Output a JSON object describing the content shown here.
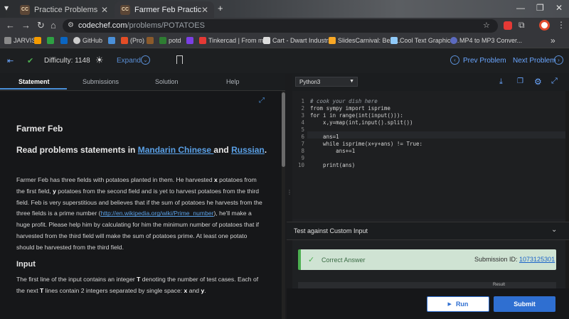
{
  "browser": {
    "tabs": [
      {
        "favicon": "CC",
        "title": "Practice Problems"
      },
      {
        "favicon": "CC",
        "title": "Farmer Feb Practice Coding Pro"
      }
    ],
    "new_tab": "+",
    "url_host": "codechef.com",
    "url_path": "/problems/POTATOES",
    "bookmarks": [
      {
        "label": "JARVIS",
        "color": "#8a8a8a"
      },
      {
        "label": "",
        "color": "#f59b00"
      },
      {
        "label": "",
        "color": "#2ea043"
      },
      {
        "label": "",
        "color": "#0a66c2"
      },
      {
        "label": "GitHub",
        "color": "#cccccc"
      },
      {
        "label": "",
        "color": "#4a90d9"
      },
      {
        "label": "(Pro)",
        "color": "#e44d26"
      },
      {
        "label": "",
        "color": "#8b5a2b"
      },
      {
        "label": "potd",
        "color": "#2e7d32"
      },
      {
        "label": "",
        "color": "#7b3fe4"
      },
      {
        "label": "Tinkercad | From mi...",
        "color": "#e53935"
      },
      {
        "label": "Cart - Dwart Industr...",
        "color": "#dddddd"
      },
      {
        "label": "SlidesCarnival: Best...",
        "color": "#f9a825"
      },
      {
        "label": "Cool Text Graphics...",
        "color": "#90caf9"
      },
      {
        "label": "MP4 to MP3 Conver...",
        "color": "#5c6bc0"
      }
    ],
    "more": "»"
  },
  "header": {
    "difficulty": "Difficulty: 1148",
    "expand": "Expand",
    "prev": "Prev Problem",
    "next": "Next Problem"
  },
  "tabs": [
    "Statement",
    "Submissions",
    "Solution",
    "Help"
  ],
  "statement": {
    "title": "Farmer Feb",
    "read_prefix": "Read problems statements in ",
    "link1": "Mandarin Chinese ",
    "and": "and ",
    "link2": "Russian",
    "period": ".",
    "para_1": "Farmer Feb has three fields with potatoes planted in them. He harvested ",
    "x": "x",
    "para_2": " potatoes from the first field, ",
    "y": "y",
    "para_3": " potatoes from the second field and is yet to harvest potatoes from the third field. Feb is very superstitious and believes that if the sum of potatoes he harvests from the three fields is a prime number (",
    "wiki": "http://en.wikipedia.org/wiki/Prime_number",
    "para_4": "), he'll make a huge profit. Please help him by calculating for him the minimum number of potatoes that if harvested from the third field will make the sum of potatoes prime. At least one potato should be harvested from the third field.",
    "input_heading": "Input",
    "input_1": "The first line of the input contains an integer ",
    "T": "T",
    "input_2": " denoting the number of test cases. Each of the next ",
    "T2": "T",
    "input_3": " lines contain 2 integers separated by single space: ",
    "x2": "x",
    "input_and": " and ",
    "y2": "y",
    "input_end": "."
  },
  "editor": {
    "language": "Python3",
    "lines": [
      "# cook your dish here",
      "from sympy import isprime",
      "for i in range(int(input())):",
      "    x,y=map(int,input().split())",
      "",
      "    ans=1",
      "    while isprime(x+y+ans) != True:",
      "        ans+=1",
      "",
      "    print(ans)"
    ]
  },
  "custom_input": "Test against Custom Input",
  "result": {
    "status": "Correct Answer",
    "submission_label": "Submission ID: ",
    "submission_id": "1073125301",
    "result_col": "Result"
  },
  "buttons": {
    "run": "Run",
    "submit": "Submit"
  }
}
